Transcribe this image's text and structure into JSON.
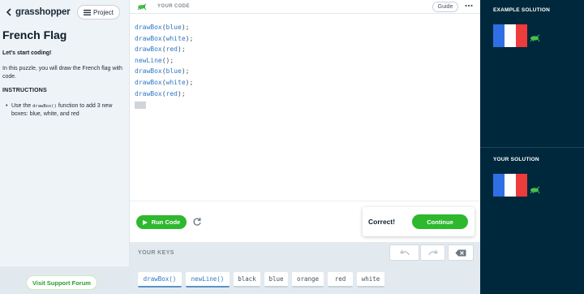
{
  "app": {
    "logo": "grasshopper",
    "project_label": "Project"
  },
  "lesson": {
    "title": "French Flag",
    "subheading": "Let's start coding!",
    "intro": "In this puzzle, you will draw the French flag with code.",
    "instructions_heading": "INSTRUCTIONS",
    "instruction_prefix": "Use the ",
    "instruction_code": "drawBox()",
    "instruction_suffix": " function to add 3 new boxes: blue, white, and red"
  },
  "support_button": "Visit Support Forum",
  "editor": {
    "header": "YOUR CODE",
    "guide_label": "Guide",
    "lines": [
      {
        "fn": "drawBox",
        "arg": "blue"
      },
      {
        "fn": "drawBox",
        "arg": "white"
      },
      {
        "fn": "drawBox",
        "arg": "red"
      },
      {
        "fn": "newLine",
        "arg": ""
      },
      {
        "fn": "drawBox",
        "arg": "blue"
      },
      {
        "fn": "drawBox",
        "arg": "white"
      },
      {
        "fn": "drawBox",
        "arg": "red"
      }
    ]
  },
  "run": {
    "run_label": "Run Code",
    "result_text": "Correct!",
    "continue_label": "Continue"
  },
  "keys": {
    "title": "YOUR KEYS",
    "items": [
      {
        "label": "drawBox()",
        "type": "function"
      },
      {
        "label": "newLine()",
        "type": "function"
      },
      {
        "label": "black",
        "type": "value"
      },
      {
        "label": "blue",
        "type": "value"
      },
      {
        "label": "orange",
        "type": "value"
      },
      {
        "label": "red",
        "type": "value"
      },
      {
        "label": "white",
        "type": "value"
      }
    ]
  },
  "solutions": {
    "example_title": "EXAMPLE SOLUTION",
    "yours_title": "YOUR SOLUTION",
    "flag_colors": [
      "#2f6fe4",
      "#ffffff",
      "#ee3b3b"
    ]
  },
  "colors": {
    "accent_green": "#2eb82e",
    "code_blue": "#2c79c4",
    "navy": "#00283c"
  }
}
